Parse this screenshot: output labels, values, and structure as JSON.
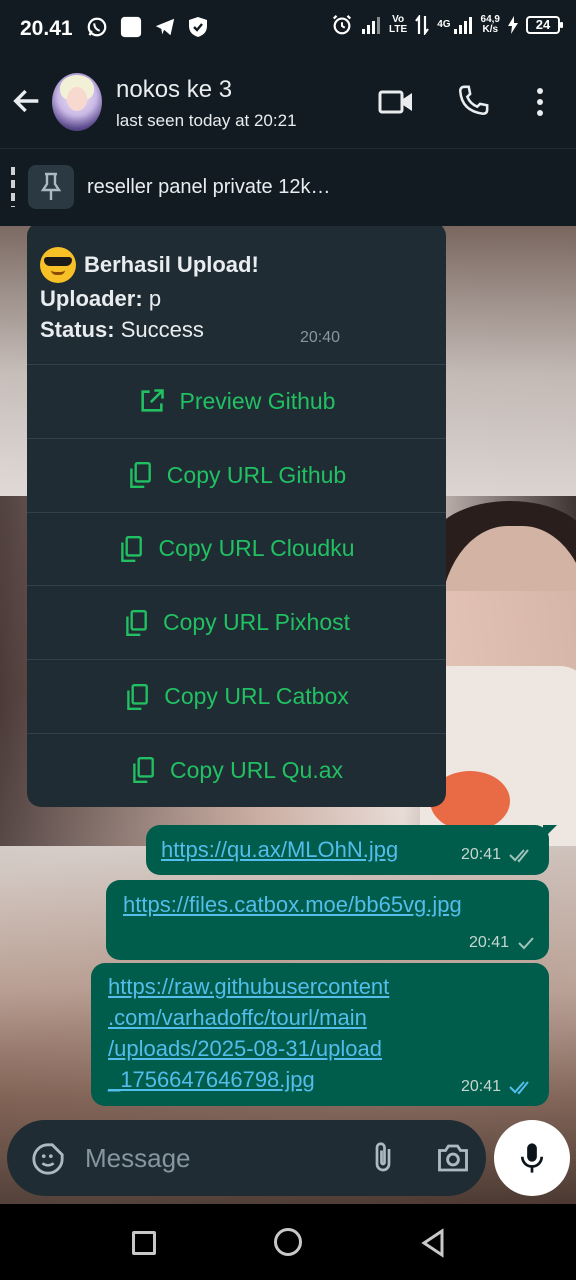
{
  "status_bar": {
    "time": "20.41",
    "net_top": "Vo",
    "net_bottom": "LTE",
    "gen": "4G",
    "speed_top": "64,9",
    "speed_bottom": "K/s",
    "battery": "24"
  },
  "header": {
    "contact_name": "nokos ke 3",
    "last_seen": "last seen today at 20:21"
  },
  "pinned": {
    "text": "reseller panel private 12k…"
  },
  "bot_message": {
    "title": "Berhasil Upload!",
    "uploader_label": "Uploader:",
    "uploader_value": "p",
    "status_label": "Status:",
    "status_value": "Success",
    "time": "20:40",
    "buttons": [
      {
        "label": "Preview Github",
        "icon": "external-link-icon"
      },
      {
        "label": "Copy URL Github",
        "icon": "copy-icon"
      },
      {
        "label": "Copy URL Cloudku",
        "icon": "copy-icon"
      },
      {
        "label": "Copy URL Pixhost",
        "icon": "copy-icon"
      },
      {
        "label": "Copy URL Catbox",
        "icon": "copy-icon"
      },
      {
        "label": "Copy URL Qu.ax",
        "icon": "copy-icon"
      }
    ]
  },
  "outgoing": [
    {
      "lines": [
        "https://qu.ax/MLOhN.jpg"
      ],
      "time": "20:41",
      "ticks": "double"
    },
    {
      "lines": [
        "https://files.catbox.moe/bb65vg.jpg"
      ],
      "time": "20:41",
      "ticks": "single"
    },
    {
      "lines": [
        "https://raw.githubusercontent",
        ".com/varhadoffc/tourl/main",
        "/uploads/2025-08-31/upload",
        "_1756647646798.jpg"
      ],
      "time": "20:41",
      "ticks": "double"
    }
  ],
  "composer": {
    "placeholder": "Message"
  },
  "colors": {
    "accent_green": "#21c063",
    "outgoing_bubble": "#005c4b",
    "incoming_bubble": "#202c33",
    "link_blue": "#53bdeb"
  }
}
